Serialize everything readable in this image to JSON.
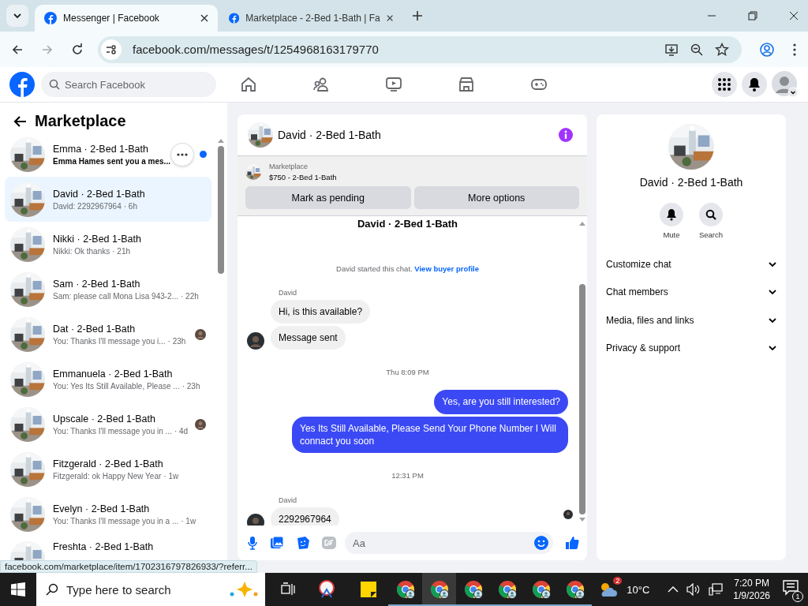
{
  "browser": {
    "tabs": [
      {
        "title": "Messenger | Facebook",
        "selected": true
      },
      {
        "title": "Marketplace - 2-Bed 1-Bath | Fa",
        "selected": false
      }
    ],
    "url": "facebook.com/messages/t/1254968163179770"
  },
  "facebook": {
    "search": {
      "placeholder": "Search Facebook"
    }
  },
  "sidebar": {
    "title": "Marketplace",
    "conversations": [
      {
        "name": "Emma · 2-Bed 1-Bath",
        "preview": "Emma Hames sent you a mes...",
        "unread": true,
        "selected": false,
        "seen": false,
        "more_button": true
      },
      {
        "name": "David · 2-Bed 1-Bath",
        "preview": "David: 2292967964",
        "time": "· 6h",
        "unread": false,
        "selected": true,
        "seen": false
      },
      {
        "name": "Nikki · 2-Bed 1-Bath",
        "preview": "Nikki: Ok thanks",
        "time": "· 21h",
        "unread": false,
        "selected": false,
        "seen": false
      },
      {
        "name": "Sam · 2-Bed 1-Bath",
        "preview": "Sam: please call Mona Lisa 943-2...",
        "time": "· 22h",
        "unread": false,
        "selected": false,
        "seen": false
      },
      {
        "name": "Dat · 2-Bed 1-Bath",
        "preview": "You: Thanks I'll message you i...",
        "time": "· 23h",
        "unread": false,
        "selected": false,
        "seen": true
      },
      {
        "name": "Emmanuela · 2-Bed 1-Bath",
        "preview": "You: Yes Its Still Available, Please ...",
        "time": "· 23h",
        "unread": false,
        "selected": false,
        "seen": false
      },
      {
        "name": "Upscale · 2-Bed 1-Bath",
        "preview": "You: Thanks I'll message you in ...",
        "time": "· 4d",
        "unread": false,
        "selected": false,
        "seen": true
      },
      {
        "name": "Fitzgerald · 2-Bed 1-Bath",
        "preview": "Fitzgerald: ok Happy New Year",
        "time": "· 1w",
        "unread": false,
        "selected": false,
        "seen": false
      },
      {
        "name": "Evelyn · 2-Bed 1-Bath",
        "preview": "You: Thanks I'll message you in a ...",
        "time": "· 1w",
        "unread": false,
        "selected": false,
        "seen": false
      },
      {
        "name": "Freshta · 2-Bed 1-Bath",
        "selected": false
      }
    ]
  },
  "chat": {
    "title": "David · 2-Bed 1-Bath",
    "listing": {
      "label": "Marketplace",
      "title": "$750 - 2-Bed 1-Bath",
      "buttons": [
        "Mark as pending",
        "More options"
      ]
    },
    "thread_title": "David · 2-Bed 1-Bath",
    "intro": {
      "text": "David started this chat.",
      "link": "View buyer profile"
    },
    "messages": [
      {
        "kind": "sender",
        "text": "David"
      },
      {
        "kind": "in",
        "text": "Hi, is this available?",
        "avatar": false
      },
      {
        "kind": "in",
        "text": "Message sent",
        "avatar": true
      },
      {
        "kind": "time",
        "text": "Thu 8:09 PM"
      },
      {
        "kind": "out",
        "text": "Yes, are you still interested?"
      },
      {
        "kind": "out",
        "text": "Yes Its Still Available, Please Send Your Phone Number I Will connact you soon"
      },
      {
        "kind": "time",
        "text": "12:31 PM"
      },
      {
        "kind": "sender",
        "text": "David"
      },
      {
        "kind": "in",
        "text": "2292967964",
        "avatar": true
      }
    ],
    "seen": true,
    "composer": {
      "placeholder": "Aa"
    }
  },
  "details": {
    "title": "David · 2-Bed 1-Bath",
    "actions": [
      {
        "kind": "mute",
        "label": "Mute"
      },
      {
        "kind": "search",
        "label": "Search"
      }
    ],
    "sections": [
      "Customize chat",
      "Chat members",
      "Media, files and links",
      "Privacy & support"
    ]
  },
  "status_url": "facebook.com/marketplace/item/1702316797826933/?referr...",
  "taskbar": {
    "search": {
      "placeholder": "Type here to search"
    },
    "weather_badge": "2",
    "temperature": "10°C",
    "time": "7:20 PM",
    "date": "1/9/2026",
    "notifications": "1"
  }
}
